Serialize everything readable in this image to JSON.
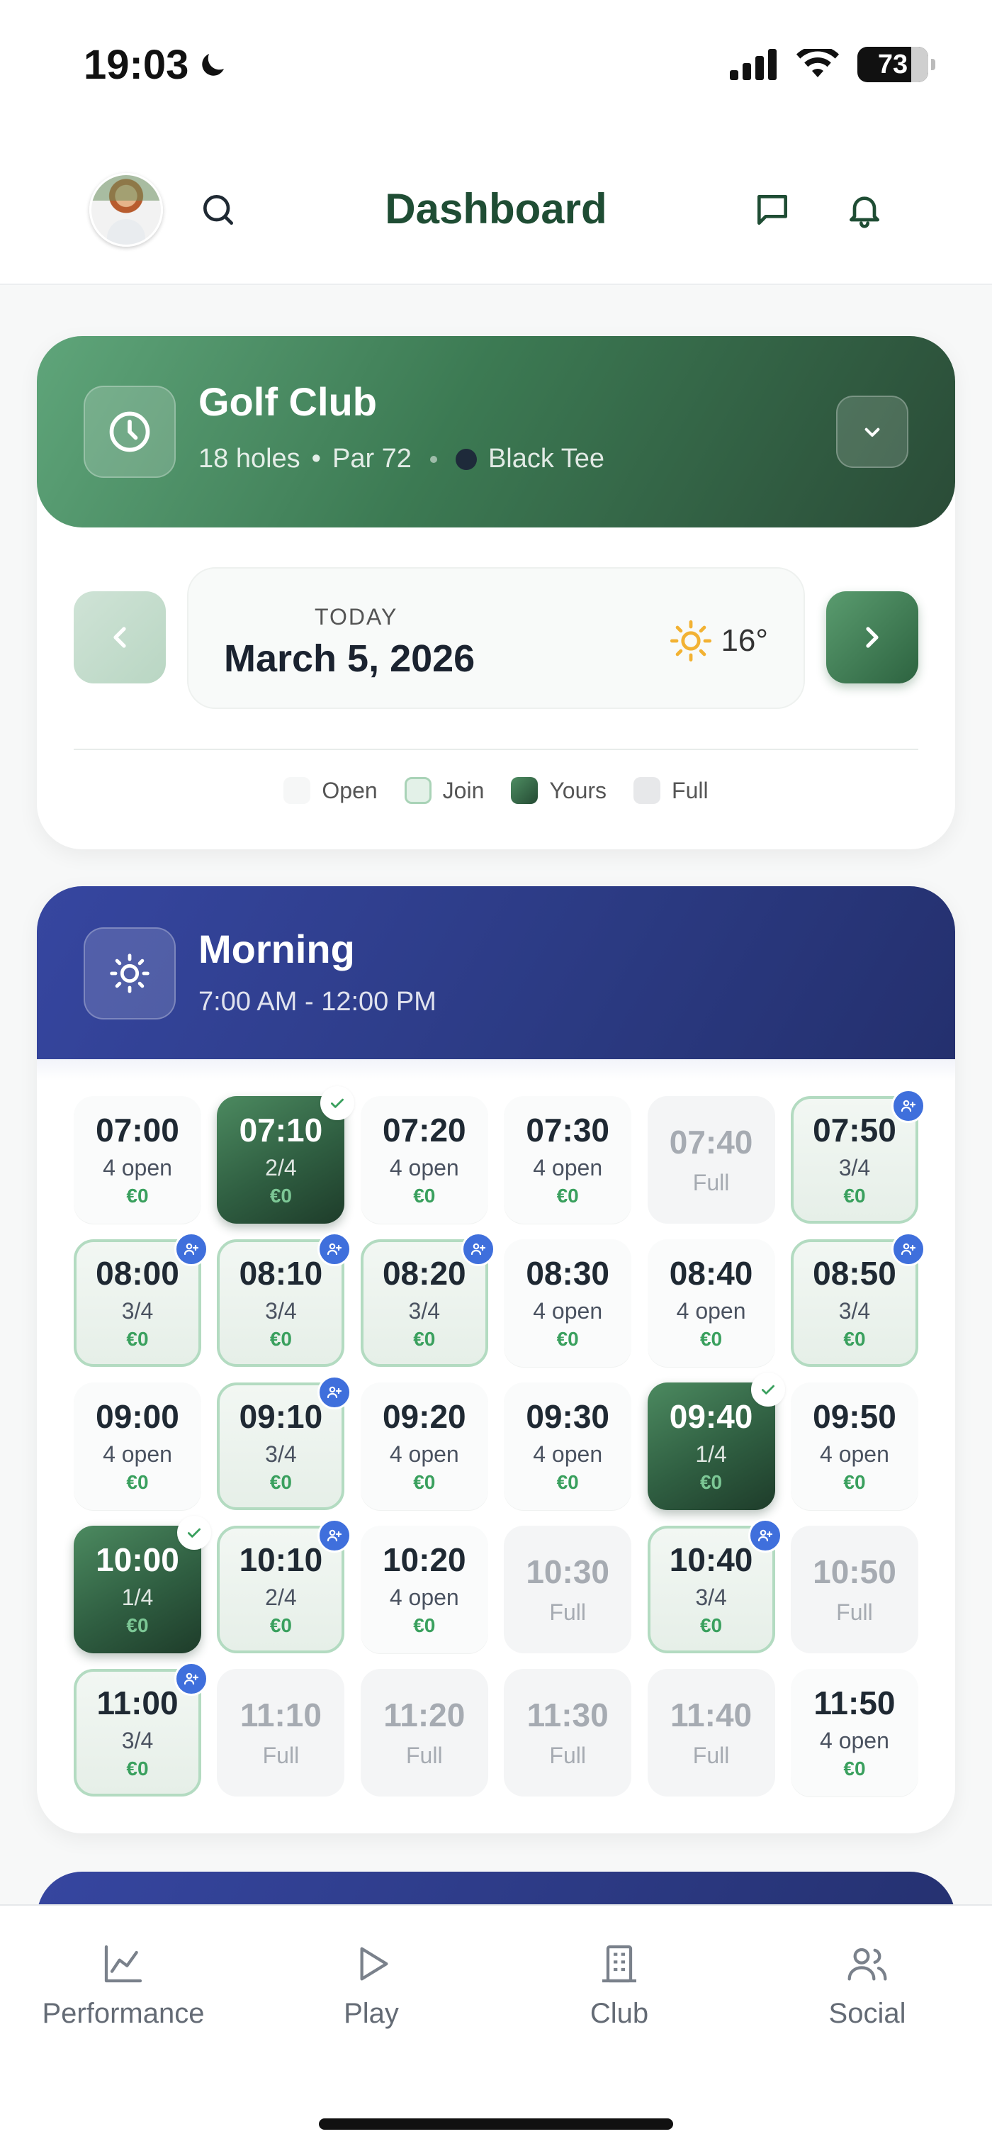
{
  "status_bar": {
    "time": "19:03",
    "battery": "73",
    "icons": [
      "moon-icon",
      "signal-icon",
      "wifi-icon",
      "battery-icon"
    ]
  },
  "header": {
    "title": "Dashboard",
    "icons": [
      "avatar",
      "search-icon",
      "message-icon",
      "bell-icon"
    ]
  },
  "course": {
    "name": "Golf Club",
    "holes": "18 holes",
    "par": "Par 72",
    "tee": "Black Tee",
    "bullet": "•",
    "date_label": "TODAY",
    "date": "March 5, 2026",
    "temperature": "16°",
    "weather_icon": "sun-icon"
  },
  "legend": {
    "open": "Open",
    "join": "Join",
    "yours": "Yours",
    "full": "Full"
  },
  "morning": {
    "title": "Morning",
    "range": "7:00 AM - 12:00 PM",
    "slots": [
      {
        "time": "07:00",
        "status": "4 open",
        "price": "€0",
        "state": "open"
      },
      {
        "time": "07:10",
        "status": "2/4",
        "price": "€0",
        "state": "yours"
      },
      {
        "time": "07:20",
        "status": "4 open",
        "price": "€0",
        "state": "open"
      },
      {
        "time": "07:30",
        "status": "4 open",
        "price": "€0",
        "state": "open"
      },
      {
        "time": "07:40",
        "status": "Full",
        "price": "",
        "state": "full"
      },
      {
        "time": "07:50",
        "status": "3/4",
        "price": "€0",
        "state": "join"
      },
      {
        "time": "08:00",
        "status": "3/4",
        "price": "€0",
        "state": "join"
      },
      {
        "time": "08:10",
        "status": "3/4",
        "price": "€0",
        "state": "join"
      },
      {
        "time": "08:20",
        "status": "3/4",
        "price": "€0",
        "state": "join"
      },
      {
        "time": "08:30",
        "status": "4 open",
        "price": "€0",
        "state": "open"
      },
      {
        "time": "08:40",
        "status": "4 open",
        "price": "€0",
        "state": "open"
      },
      {
        "time": "08:50",
        "status": "3/4",
        "price": "€0",
        "state": "join"
      },
      {
        "time": "09:00",
        "status": "4 open",
        "price": "€0",
        "state": "open"
      },
      {
        "time": "09:10",
        "status": "3/4",
        "price": "€0",
        "state": "join"
      },
      {
        "time": "09:20",
        "status": "4 open",
        "price": "€0",
        "state": "open"
      },
      {
        "time": "09:30",
        "status": "4 open",
        "price": "€0",
        "state": "open"
      },
      {
        "time": "09:40",
        "status": "1/4",
        "price": "€0",
        "state": "yours"
      },
      {
        "time": "09:50",
        "status": "4 open",
        "price": "€0",
        "state": "open"
      },
      {
        "time": "10:00",
        "status": "1/4",
        "price": "€0",
        "state": "yours"
      },
      {
        "time": "10:10",
        "status": "2/4",
        "price": "€0",
        "state": "join"
      },
      {
        "time": "10:20",
        "status": "4 open",
        "price": "€0",
        "state": "open"
      },
      {
        "time": "10:30",
        "status": "Full",
        "price": "",
        "state": "full"
      },
      {
        "time": "10:40",
        "status": "3/4",
        "price": "€0",
        "state": "join"
      },
      {
        "time": "10:50",
        "status": "Full",
        "price": "",
        "state": "full"
      },
      {
        "time": "11:00",
        "status": "3/4",
        "price": "€0",
        "state": "join"
      },
      {
        "time": "11:10",
        "status": "Full",
        "price": "",
        "state": "full"
      },
      {
        "time": "11:20",
        "status": "Full",
        "price": "",
        "state": "full"
      },
      {
        "time": "11:30",
        "status": "Full",
        "price": "",
        "state": "full"
      },
      {
        "time": "11:40",
        "status": "Full",
        "price": "",
        "state": "full"
      },
      {
        "time": "11:50",
        "status": "4 open",
        "price": "€0",
        "state": "open"
      }
    ]
  },
  "tabs": [
    {
      "label": "Performance",
      "icon": "chart-line-icon"
    },
    {
      "label": "Play",
      "icon": "play-icon"
    },
    {
      "label": "Club",
      "icon": "building-icon"
    },
    {
      "label": "Social",
      "icon": "users-icon"
    }
  ],
  "colors": {
    "brand_green": "#2f5e41",
    "join_border": "#b3dbc1",
    "morning_blue": "#2b3a82",
    "price_green": "#3aa05e",
    "join_badge": "#3f6fdc"
  }
}
